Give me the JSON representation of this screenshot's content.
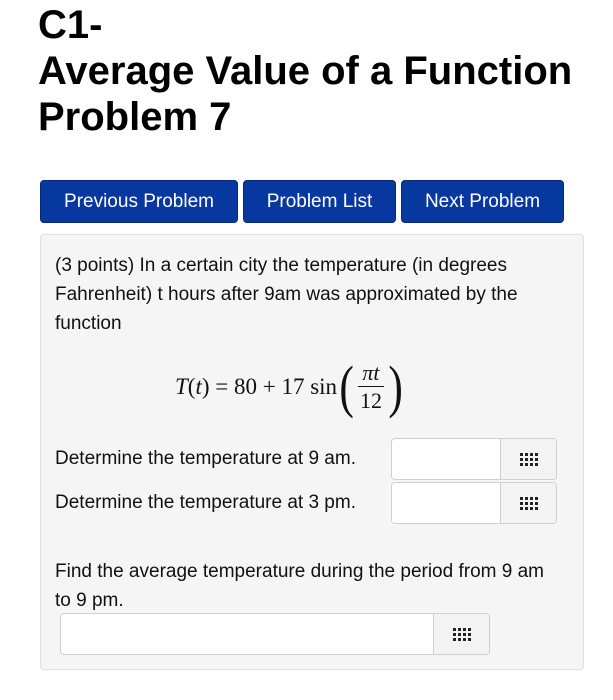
{
  "header": {
    "line1": "C1-",
    "line2": "Average Value of a Function",
    "line3": "Problem 7"
  },
  "nav": {
    "previous_label": "Previous Problem",
    "list_label": "Problem List",
    "next_label": "Next Problem"
  },
  "problem": {
    "intro": "(3 points) In a certain city the temperature (in degrees Fahrenheit) t hours after 9am was approximated by the function",
    "formula": {
      "lhs": "T(t) = 80 + 17 sin",
      "numerator": "πt",
      "denominator": "12"
    },
    "q1": {
      "label": "Determine the temperature at 9 am.",
      "value": ""
    },
    "q2": {
      "label": "Determine the temperature at 3 pm.",
      "value": ""
    },
    "q3": {
      "label": "Find the average temperature during the period from 9 am to 9 pm.",
      "value": ""
    }
  },
  "icons": {
    "answer_tool": "grid-keypad-icon"
  }
}
